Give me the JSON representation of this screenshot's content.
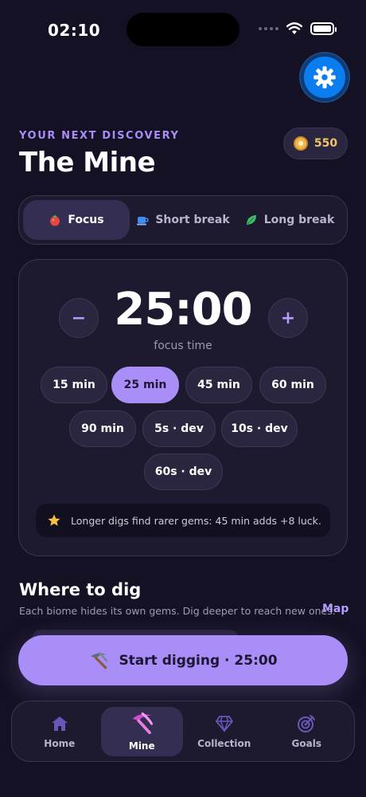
{
  "status_bar": {
    "time": "02:10"
  },
  "header": {
    "eyebrow": "YOUR NEXT DISCOVERY",
    "title": "The Mine",
    "coins": "550"
  },
  "mode_tabs": [
    {
      "label": "Focus",
      "icon": "tomato-icon",
      "active": true
    },
    {
      "label": "Short break",
      "icon": "coffee-cup-icon",
      "active": false
    },
    {
      "label": "Long break",
      "icon": "leaf-icon",
      "active": false
    }
  ],
  "timer": {
    "value": "25:00",
    "label": "focus time",
    "decrease": "−",
    "increase": "+",
    "presets": [
      "15 min",
      "25 min",
      "45 min",
      "60 min",
      "90 min",
      "5s · dev",
      "10s · dev",
      "60s · dev"
    ],
    "selected_preset": "25 min",
    "tip": "Longer digs find rarer gems: 45 min adds +8 luck."
  },
  "where_to_dig": {
    "title": "Where to dig",
    "subtitle": "Each biome hides its own gems. Dig deeper to reach new ones.",
    "map_link": "Map"
  },
  "start_button": {
    "label": "Start digging · 25:00"
  },
  "tabbar": [
    {
      "label": "Home",
      "icon": "house-icon",
      "active": false
    },
    {
      "label": "Mine",
      "icon": "pickaxe-icon",
      "active": true
    },
    {
      "label": "Collection",
      "icon": "gem-icon",
      "active": false
    },
    {
      "label": "Goals",
      "icon": "target-icon",
      "active": false
    }
  ],
  "colors": {
    "background": "#141124",
    "accent": "#a98ef7",
    "settings_button": "#0a7df0",
    "coin": "#f0b64a"
  }
}
